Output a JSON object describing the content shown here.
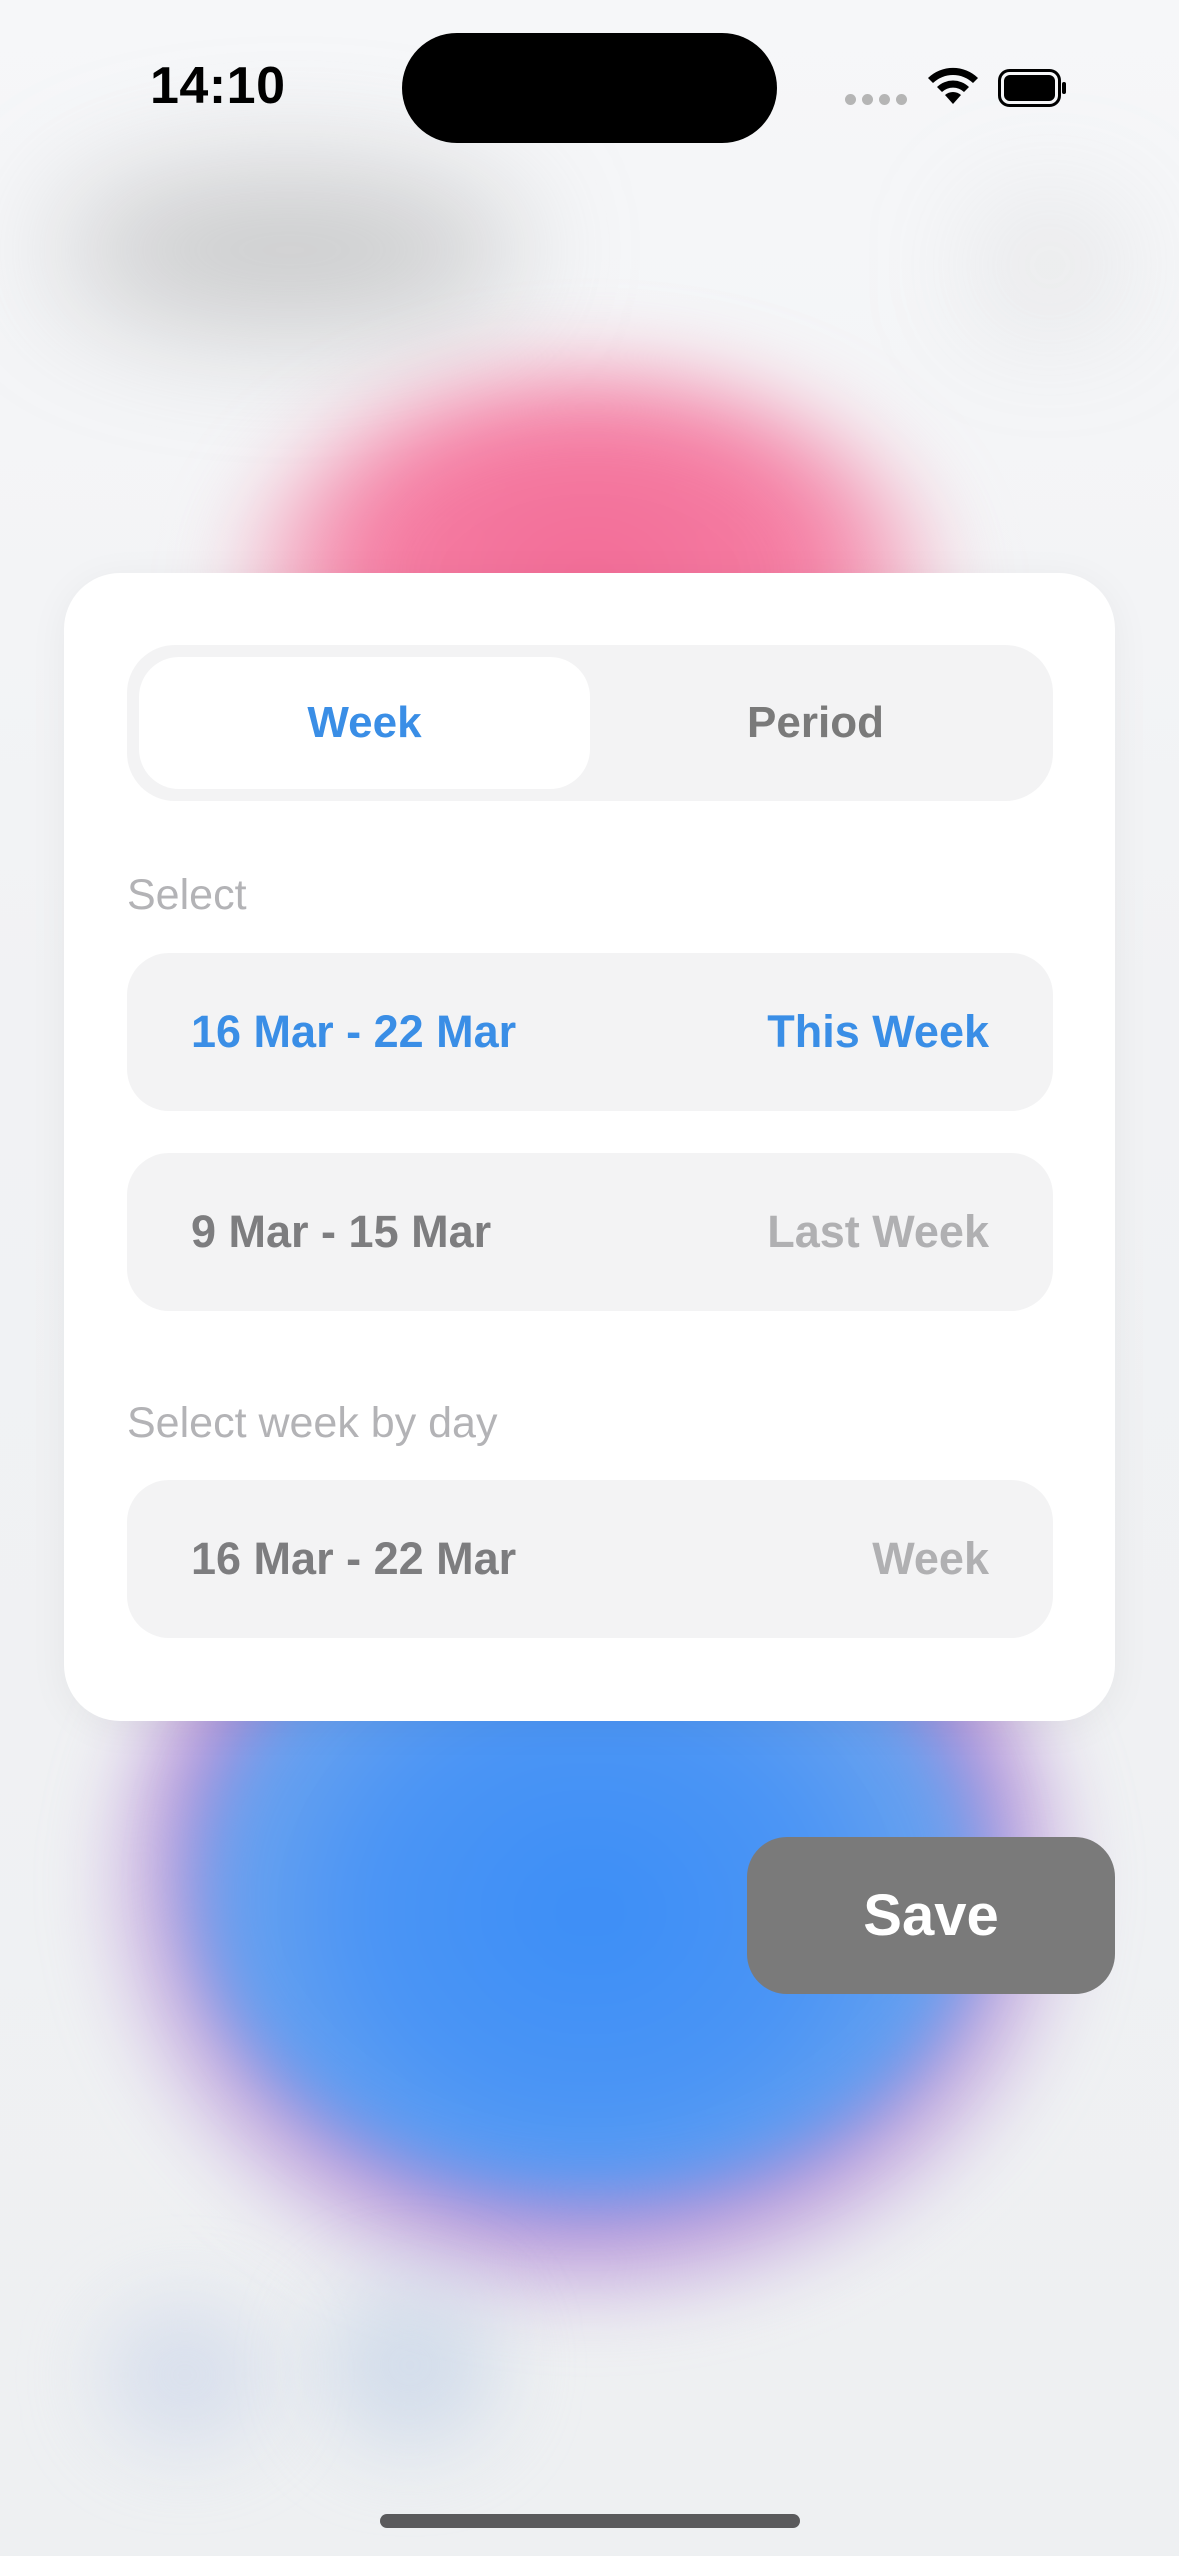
{
  "status_bar": {
    "time": "14:10",
    "icons": [
      "signal-dots-icon",
      "wifi-icon",
      "battery-icon"
    ]
  },
  "segmented_control": {
    "options": [
      {
        "label": "Week",
        "selected": true
      },
      {
        "label": "Period",
        "selected": false
      }
    ]
  },
  "select_section": {
    "label": "Select",
    "rows": [
      {
        "range": "16 Mar - 22 Mar",
        "tag": "This Week",
        "selected": true
      },
      {
        "range": "9 Mar - 15 Mar",
        "tag": "Last Week",
        "selected": false
      }
    ]
  },
  "select_by_day_section": {
    "label": "Select week by day",
    "row": {
      "range": "16 Mar - 22 Mar",
      "tag": "Week"
    }
  },
  "actions": {
    "save_label": "Save"
  },
  "colors": {
    "accent": "#3a8ee6",
    "save_button": "#7a7a7a",
    "row_background": "#f3f3f4"
  }
}
